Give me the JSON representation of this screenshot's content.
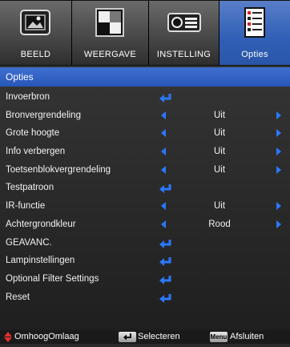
{
  "tabs": [
    {
      "label": "BEELD",
      "icon": "picture-icon"
    },
    {
      "label": "WEERGAVE",
      "icon": "display-icon"
    },
    {
      "label": "INSTELLING",
      "icon": "projector-icon"
    },
    {
      "label": "Opties",
      "icon": "options-list-icon",
      "active": true
    }
  ],
  "header": {
    "title": "Opties"
  },
  "rows": [
    {
      "label": "Invoerbron",
      "control": "enter"
    },
    {
      "label": "Bronvergrendeling",
      "control": "select",
      "value": "Uit"
    },
    {
      "label": "Grote hoogte",
      "control": "select",
      "value": "Uit"
    },
    {
      "label": "Info verbergen",
      "control": "select",
      "value": "Uit"
    },
    {
      "label": "Toetsenblokvergrendeling",
      "control": "select",
      "value": "Uit"
    },
    {
      "label": "Testpatroon",
      "control": "enter"
    },
    {
      "label": "IR-functie",
      "control": "select",
      "value": "Uit"
    },
    {
      "label": "Achtergrondkleur",
      "control": "select",
      "value": "Rood"
    },
    {
      "label": "GEAVANC.",
      "control": "enter"
    },
    {
      "label": "Lampinstellingen",
      "control": "enter"
    },
    {
      "label": "Optional Filter Settings",
      "control": "enter"
    },
    {
      "label": "Reset",
      "control": "enter"
    }
  ],
  "footer": {
    "navigate_label": "OmhoogOmlaag",
    "select_label": "Selecteren",
    "menu_key": "Menu",
    "exit_label": "Afsluiten"
  },
  "colors": {
    "accent": "#2a78ff",
    "active_tab": "#2f5fb6",
    "header": "#3366cc",
    "footer_arrows": "#e03030"
  }
}
